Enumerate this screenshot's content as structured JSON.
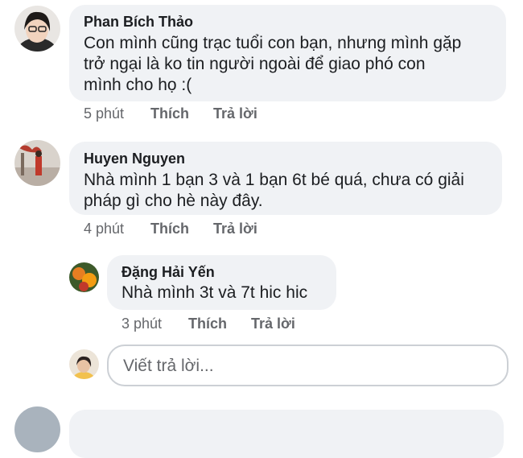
{
  "comments": [
    {
      "author": "Phan Bích Thảo",
      "lines": [
        "Con mình cũng trạc tuổi con bạn, nhưng mình gặp",
        "trở ngại là ko tin người ngoài để giao phó con",
        "mình cho họ :("
      ],
      "time": "5 phút",
      "like_label": "Thích",
      "reply_label": "Trả lời"
    },
    {
      "author": "Huyen Nguyen",
      "lines": [
        "Nhà mình 1 bạn 3 và 1 bạn 6t bé quá, chưa có giải",
        "pháp gì cho hè này đây."
      ],
      "time": "4 phút",
      "like_label": "Thích",
      "reply_label": "Trả lời"
    }
  ],
  "reply": {
    "author": "Đặng Hải Yến",
    "text": "Nhà mình 3t và 7t hic hic",
    "time": "3 phút",
    "like_label": "Thích",
    "reply_label": "Trả lời"
  },
  "reply_input": {
    "placeholder": "Viết trả lời..."
  }
}
